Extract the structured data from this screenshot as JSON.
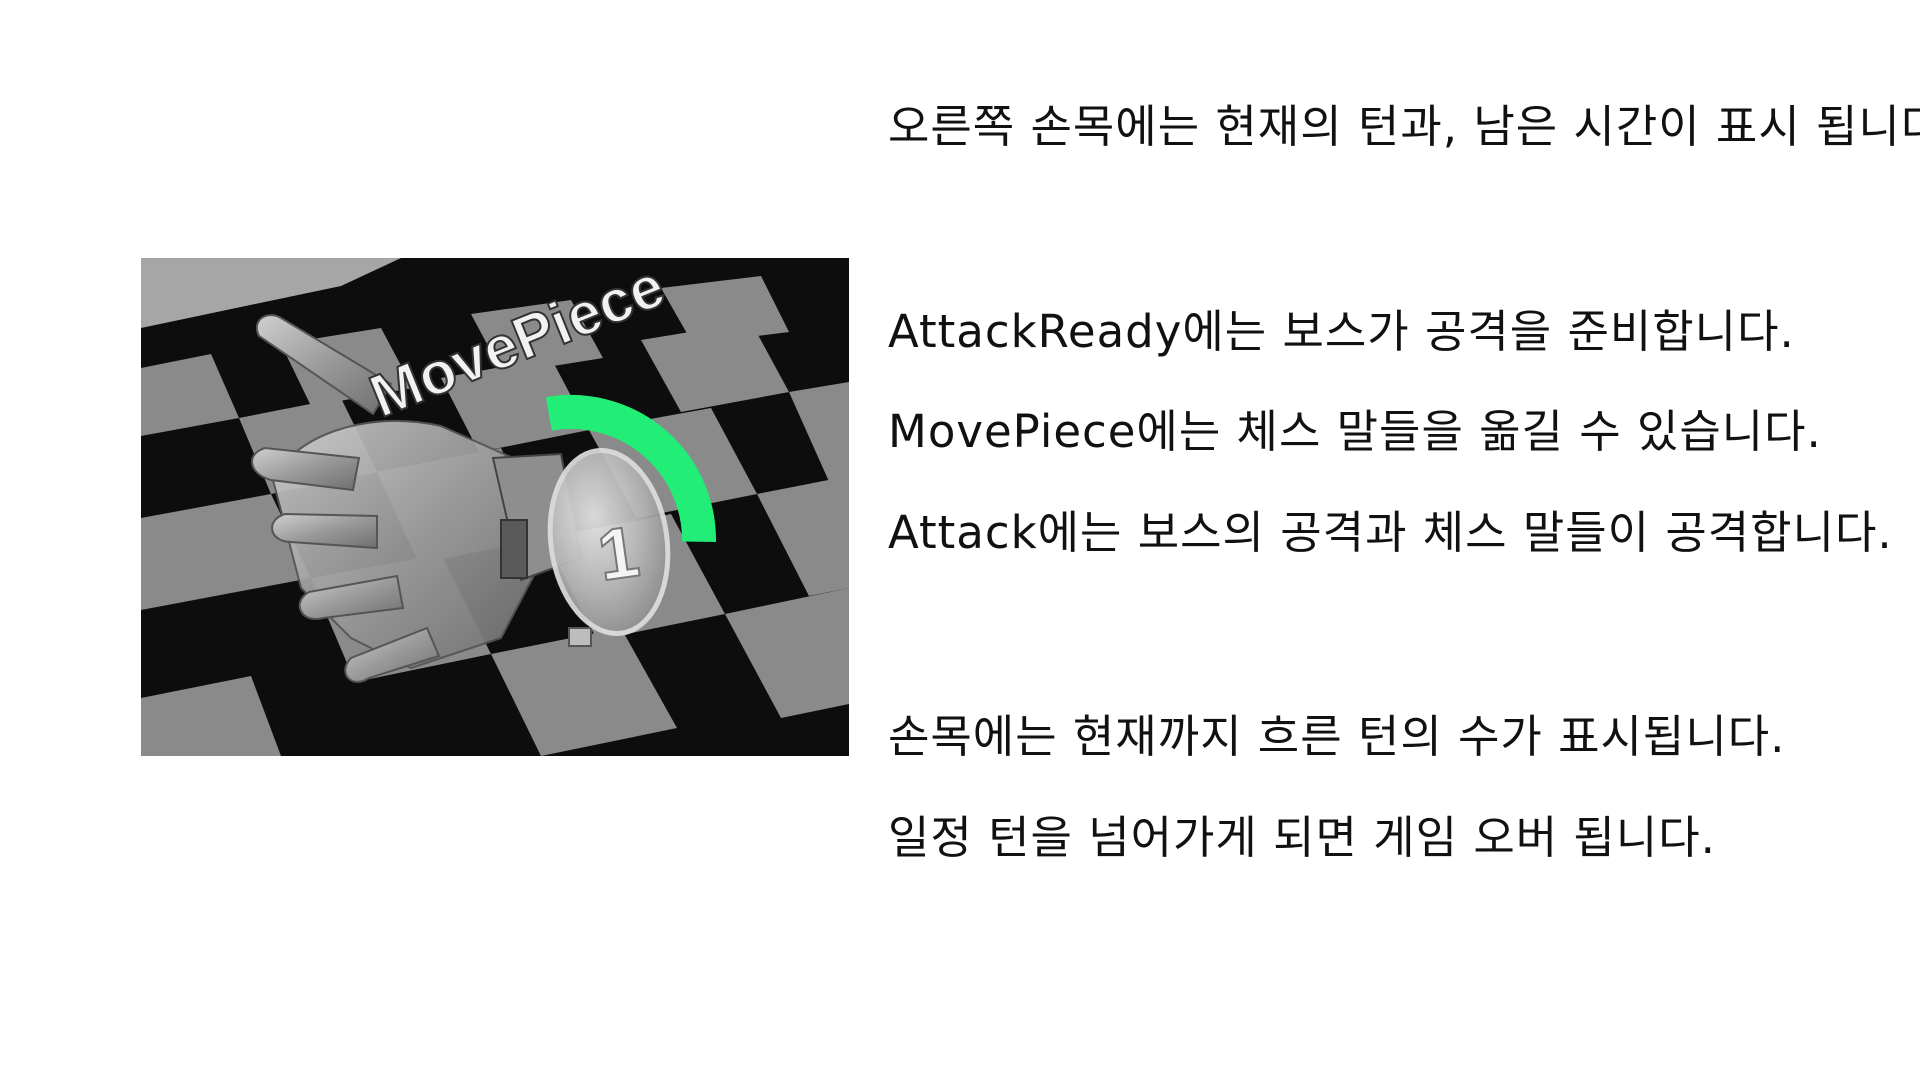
{
  "game_view": {
    "phase_label": "MovePiece",
    "turn_number": "1",
    "timer_color": "#22ee77",
    "timer_remaining_fraction": 0.28,
    "board_light_color": "#8a8a8a",
    "board_dark_color": "#0d0d0d",
    "wall_color": "#a6a6a6",
    "glove_icon": "glove-hand-icon"
  },
  "description": {
    "lines": [
      "오른쪽 손목에는 현재의 턴과, 남은 시간이 표시 됩니다.",
      "AttackReady에는 보스가 공격을 준비합니다.",
      "MovePiece에는 체스 말들을 옮길 수 있습니다.",
      "Attack에는 보스의 공격과 체스 말들이 공격합니다.",
      "손목에는 현재까지 흐른 턴의 수가 표시됩니다.",
      "일정 턴을 넘어가게 되면 게임 오버 됩니다."
    ]
  }
}
